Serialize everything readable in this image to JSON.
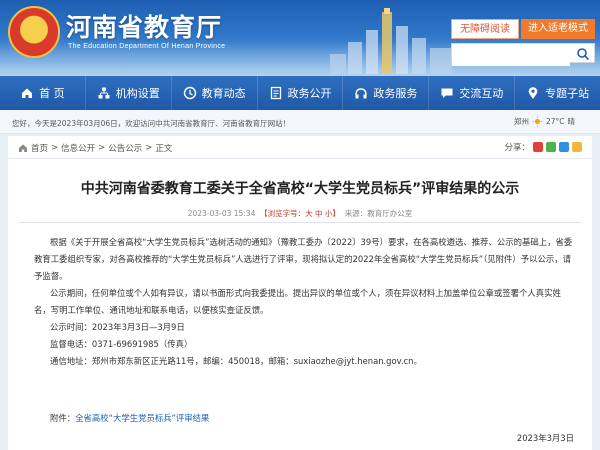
{
  "banner": {
    "title": "河南省教育厅",
    "subtitle": "The Education Department Of Henan Province",
    "accessibility_label": "无障碍阅读",
    "elder_mode_label": "进入适老模式",
    "search_placeholder": "",
    "colors": {
      "accent": "#f07b2c",
      "nav": "#1f58a6"
    }
  },
  "nav": {
    "items": [
      {
        "label": "首 页",
        "icon": "home-icon"
      },
      {
        "label": "机构设置",
        "icon": "org-icon"
      },
      {
        "label": "教育动态",
        "icon": "news-icon"
      },
      {
        "label": "政务公开",
        "icon": "doc-icon"
      },
      {
        "label": "政务服务",
        "icon": "service-icon"
      },
      {
        "label": "交流互动",
        "icon": "chat-icon"
      },
      {
        "label": "专题子站",
        "icon": "pin-icon"
      }
    ]
  },
  "infobar": {
    "welcome": "您好，今天是2023年03月06日，欢迎访问中共河南省教育厅、河南省教育厅网站！",
    "city": "郑州",
    "temp": "27°C",
    "weather": "晴"
  },
  "breadcrumb": {
    "items": [
      "首页",
      "信息公开",
      "公告公示",
      "正文"
    ],
    "separator": ">"
  },
  "share": {
    "label": "分享："
  },
  "article": {
    "title": "中共河南省委教育工委关于全省高校“大学生党员标兵”评审结果的公示",
    "meta_date": "2023-03-03 15:34",
    "meta_fontsize": "【浏览字号：大 中 小】",
    "meta_source": "来源：教育厅办公室",
    "p1": "根据《关于开展全省高校“大学生党员标兵”选树活动的通知》（豫教工委办〔2022〕39号）要求，在各高校遴选、推荐、公示的基础上，省委教育工委组织专家，对各高校推荐的“大学生党员标兵”人选进行了评审，现将拟认定的2022年全省高校“大学生党员标兵”（见附件）予以公示，请予监督。",
    "p2": "公示期间，任何单位或个人如有异议，请以书面形式向我委提出。提出异议的单位或个人，须在异议材料上加盖单位公章或签署个人真实姓名，写明工作单位、通讯地址和联系电话，以便核实查证反馈。",
    "time_line": "公示时间：2023年3月3日—3月9日",
    "phone_line": "监督电话：0371-69691985（传真）",
    "address_line": "通信地址：郑州市郑东新区正光路11号，邮编：450018，邮箱：suxiaozhe@jyt.henan.gov.cn。",
    "attach_prefix": "附件：",
    "attach_link": "全省高校“大学生党员标兵”评审结果",
    "date": "2023年3月3日"
  }
}
